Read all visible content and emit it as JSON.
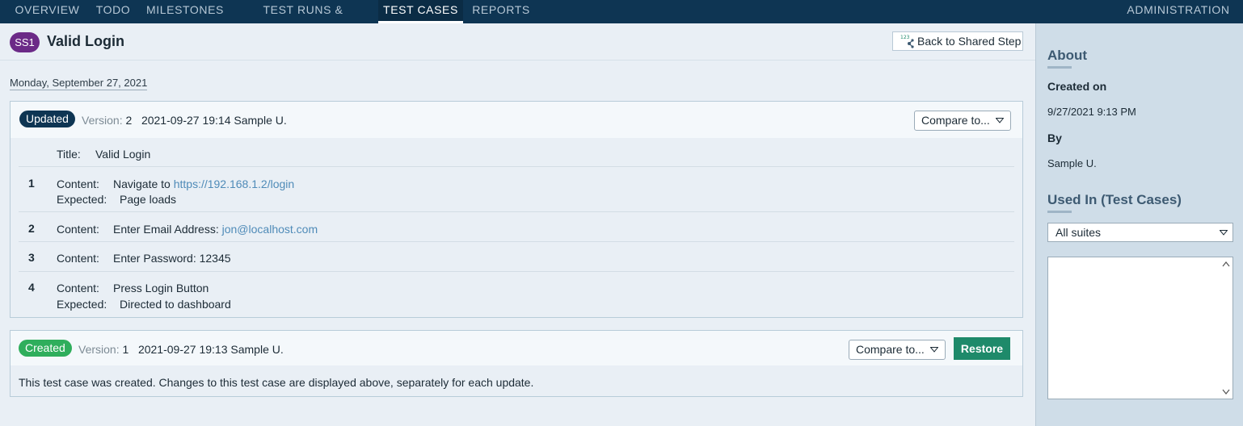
{
  "nav": {
    "items": [
      {
        "label": "OVERVIEW"
      },
      {
        "label": "TODO"
      },
      {
        "label": "MILESTONES"
      },
      {
        "label": "TEST RUNS & RESULTS"
      },
      {
        "label": "TEST CASES"
      },
      {
        "label": "REPORTS"
      }
    ],
    "active": "TEST CASES",
    "admin_label": "ADMINISTRATION"
  },
  "header": {
    "badge": "SS1",
    "title": "Valid Login",
    "back_button": "Back to Shared Step"
  },
  "date_label": "Monday, September 27, 2021",
  "history": [
    {
      "status": "Updated",
      "status_color": "#0e3553",
      "version_label": "Version:",
      "version": "2",
      "timestamp_user": "2021-09-27 19:14 Sample U.",
      "compare_label": "Compare to...",
      "title_label": "Title:",
      "title_value": "Valid Login",
      "steps": [
        {
          "num": "1",
          "content_label": "Content:",
          "content_text": "Navigate to ",
          "content_link": "https://192.168.1.2/login",
          "expected_label": "Expected:",
          "expected": "Page loads"
        },
        {
          "num": "2",
          "content_label": "Content:",
          "content_text": "Enter Email Address: ",
          "content_link": "jon@localhost.com"
        },
        {
          "num": "3",
          "content_label": "Content:",
          "content_text": "Enter Password: 12345"
        },
        {
          "num": "4",
          "content_label": "Content:",
          "content_text": "Press Login Button",
          "expected_label": "Expected:",
          "expected": "Directed to dashboard"
        }
      ]
    },
    {
      "status": "Created",
      "status_color": "#2fae5c",
      "version_label": "Version:",
      "version": "1",
      "timestamp_user": "2021-09-27 19:13 Sample U.",
      "compare_label": "Compare to...",
      "restore_label": "Restore",
      "note": "This test case was created. Changes to this test case are displayed above, separately for each update."
    }
  ],
  "sidebar": {
    "about_heading": "About",
    "created_on_label": "Created on",
    "created_on_value": "9/27/2021 9:13 PM",
    "by_label": "By",
    "by_value": "Sample U.",
    "used_in_heading": "Used In (Test Cases)",
    "suites_selected": "All suites"
  },
  "icons": {
    "back": "shared-step-icon",
    "caret": "caret-down-icon"
  },
  "colors": {
    "nav_bg": "#0e3553",
    "sidebar_bg": "#cfdde8",
    "link": "#4f8bb8",
    "restore": "#1e8a6a"
  }
}
